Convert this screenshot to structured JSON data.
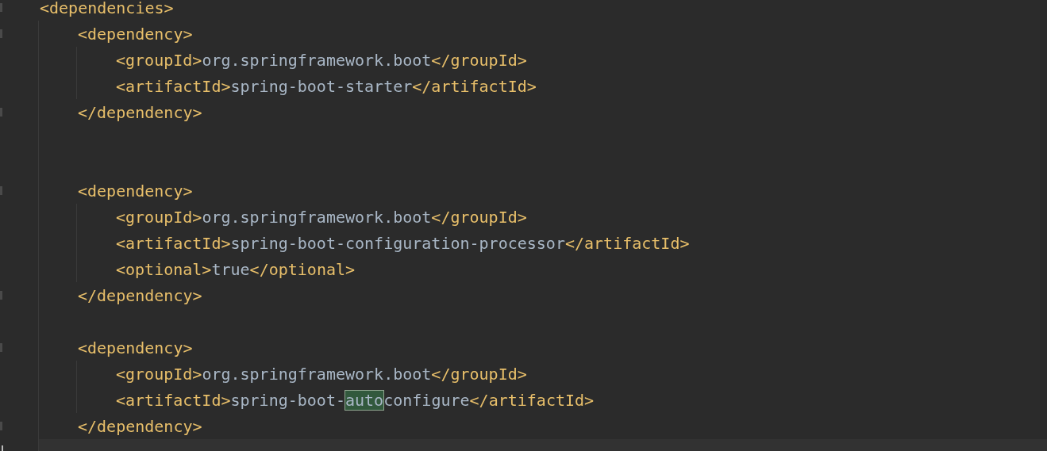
{
  "editor": {
    "code": [
      {
        "kind": "element",
        "open": "<dependencies>",
        "children": [
          {
            "kind": "element",
            "open": "<dependency>",
            "close": "</dependency>",
            "children": [
              {
                "kind": "line",
                "segments": [
                  {
                    "kind": "tag",
                    "text": "<groupId>"
                  },
                  {
                    "kind": "value",
                    "text": "org.springframework.boot"
                  },
                  {
                    "kind": "tag",
                    "text": "</groupId>"
                  }
                ]
              },
              {
                "kind": "line",
                "segments": [
                  {
                    "kind": "tag",
                    "text": "<artifactId>"
                  },
                  {
                    "kind": "value",
                    "text": "spring-boot-starter"
                  },
                  {
                    "kind": "tag",
                    "text": "</artifactId>"
                  }
                ]
              }
            ]
          },
          {
            "kind": "blank"
          },
          {
            "kind": "blank"
          },
          {
            "kind": "element",
            "open": "<dependency>",
            "close": "</dependency>",
            "children": [
              {
                "kind": "line",
                "segments": [
                  {
                    "kind": "tag",
                    "text": "<groupId>"
                  },
                  {
                    "kind": "value",
                    "text": "org.springframework.boot"
                  },
                  {
                    "kind": "tag",
                    "text": "</groupId>"
                  }
                ]
              },
              {
                "kind": "line",
                "segments": [
                  {
                    "kind": "tag",
                    "text": "<artifactId>"
                  },
                  {
                    "kind": "value",
                    "text": "spring-boot-configuration-processor"
                  },
                  {
                    "kind": "tag",
                    "text": "</artifactId>"
                  }
                ]
              },
              {
                "kind": "line",
                "segments": [
                  {
                    "kind": "tag",
                    "text": "<optional>"
                  },
                  {
                    "kind": "value",
                    "text": "true"
                  },
                  {
                    "kind": "tag",
                    "text": "</optional>"
                  }
                ]
              }
            ]
          },
          {
            "kind": "blank"
          },
          {
            "kind": "element",
            "open": "<dependency>",
            "close": "</dependency>",
            "children": [
              {
                "kind": "line",
                "segments": [
                  {
                    "kind": "tag",
                    "text": "<groupId>"
                  },
                  {
                    "kind": "value",
                    "text": "org.springframework.boot"
                  },
                  {
                    "kind": "tag",
                    "text": "</groupId>"
                  }
                ]
              },
              {
                "kind": "line",
                "segments": [
                  {
                    "kind": "tag",
                    "text": "<artifactId>"
                  },
                  {
                    "kind": "value",
                    "text": "spring-boot-"
                  },
                  {
                    "kind": "match",
                    "text": "auto"
                  },
                  {
                    "kind": "value",
                    "text": "configure"
                  },
                  {
                    "kind": "tag",
                    "text": "</artifactId>"
                  }
                ]
              }
            ]
          },
          {
            "kind": "current"
          }
        ]
      }
    ]
  }
}
